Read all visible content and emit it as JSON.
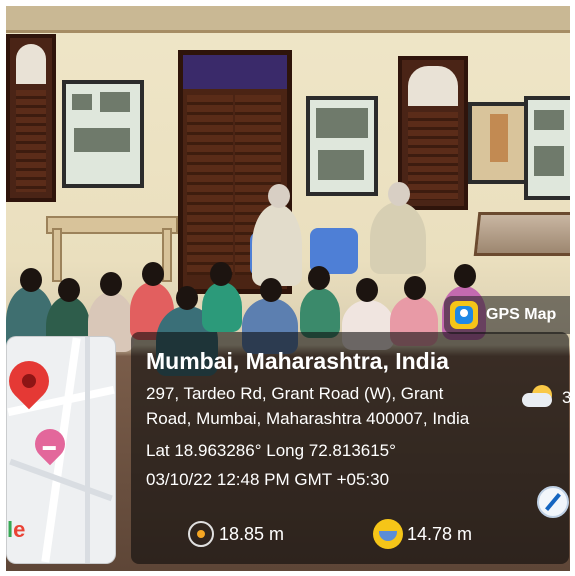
{
  "badge": {
    "label": "GPS Map"
  },
  "location": {
    "city": "Mumbai, Maharashtra, India",
    "address_line1": "297, Tardeo Rd, Grant Road (W), Grant",
    "address_line2": "Road, Mumbai, Maharashtra 400007, India",
    "coordinates": "Lat 18.963286° Long 72.813615°",
    "datetime": "03/10/22 12:48 PM GMT +05:30"
  },
  "weather": {
    "temperature": "3"
  },
  "metrics": {
    "accuracy": "18.85 m",
    "altitude": "14.78 m"
  },
  "map": {
    "logo_text": "le"
  },
  "icons": [
    "map-pin-icon",
    "hotel-pin-icon",
    "gps-map-app-icon",
    "weather-icon",
    "compass-icon",
    "accuracy-icon",
    "altitude-icon"
  ],
  "colors": {
    "overlay": "#0a0a0a",
    "pin": "#e53935",
    "hotel_pin": "#e3679b",
    "app_icon": "#f5c518"
  }
}
